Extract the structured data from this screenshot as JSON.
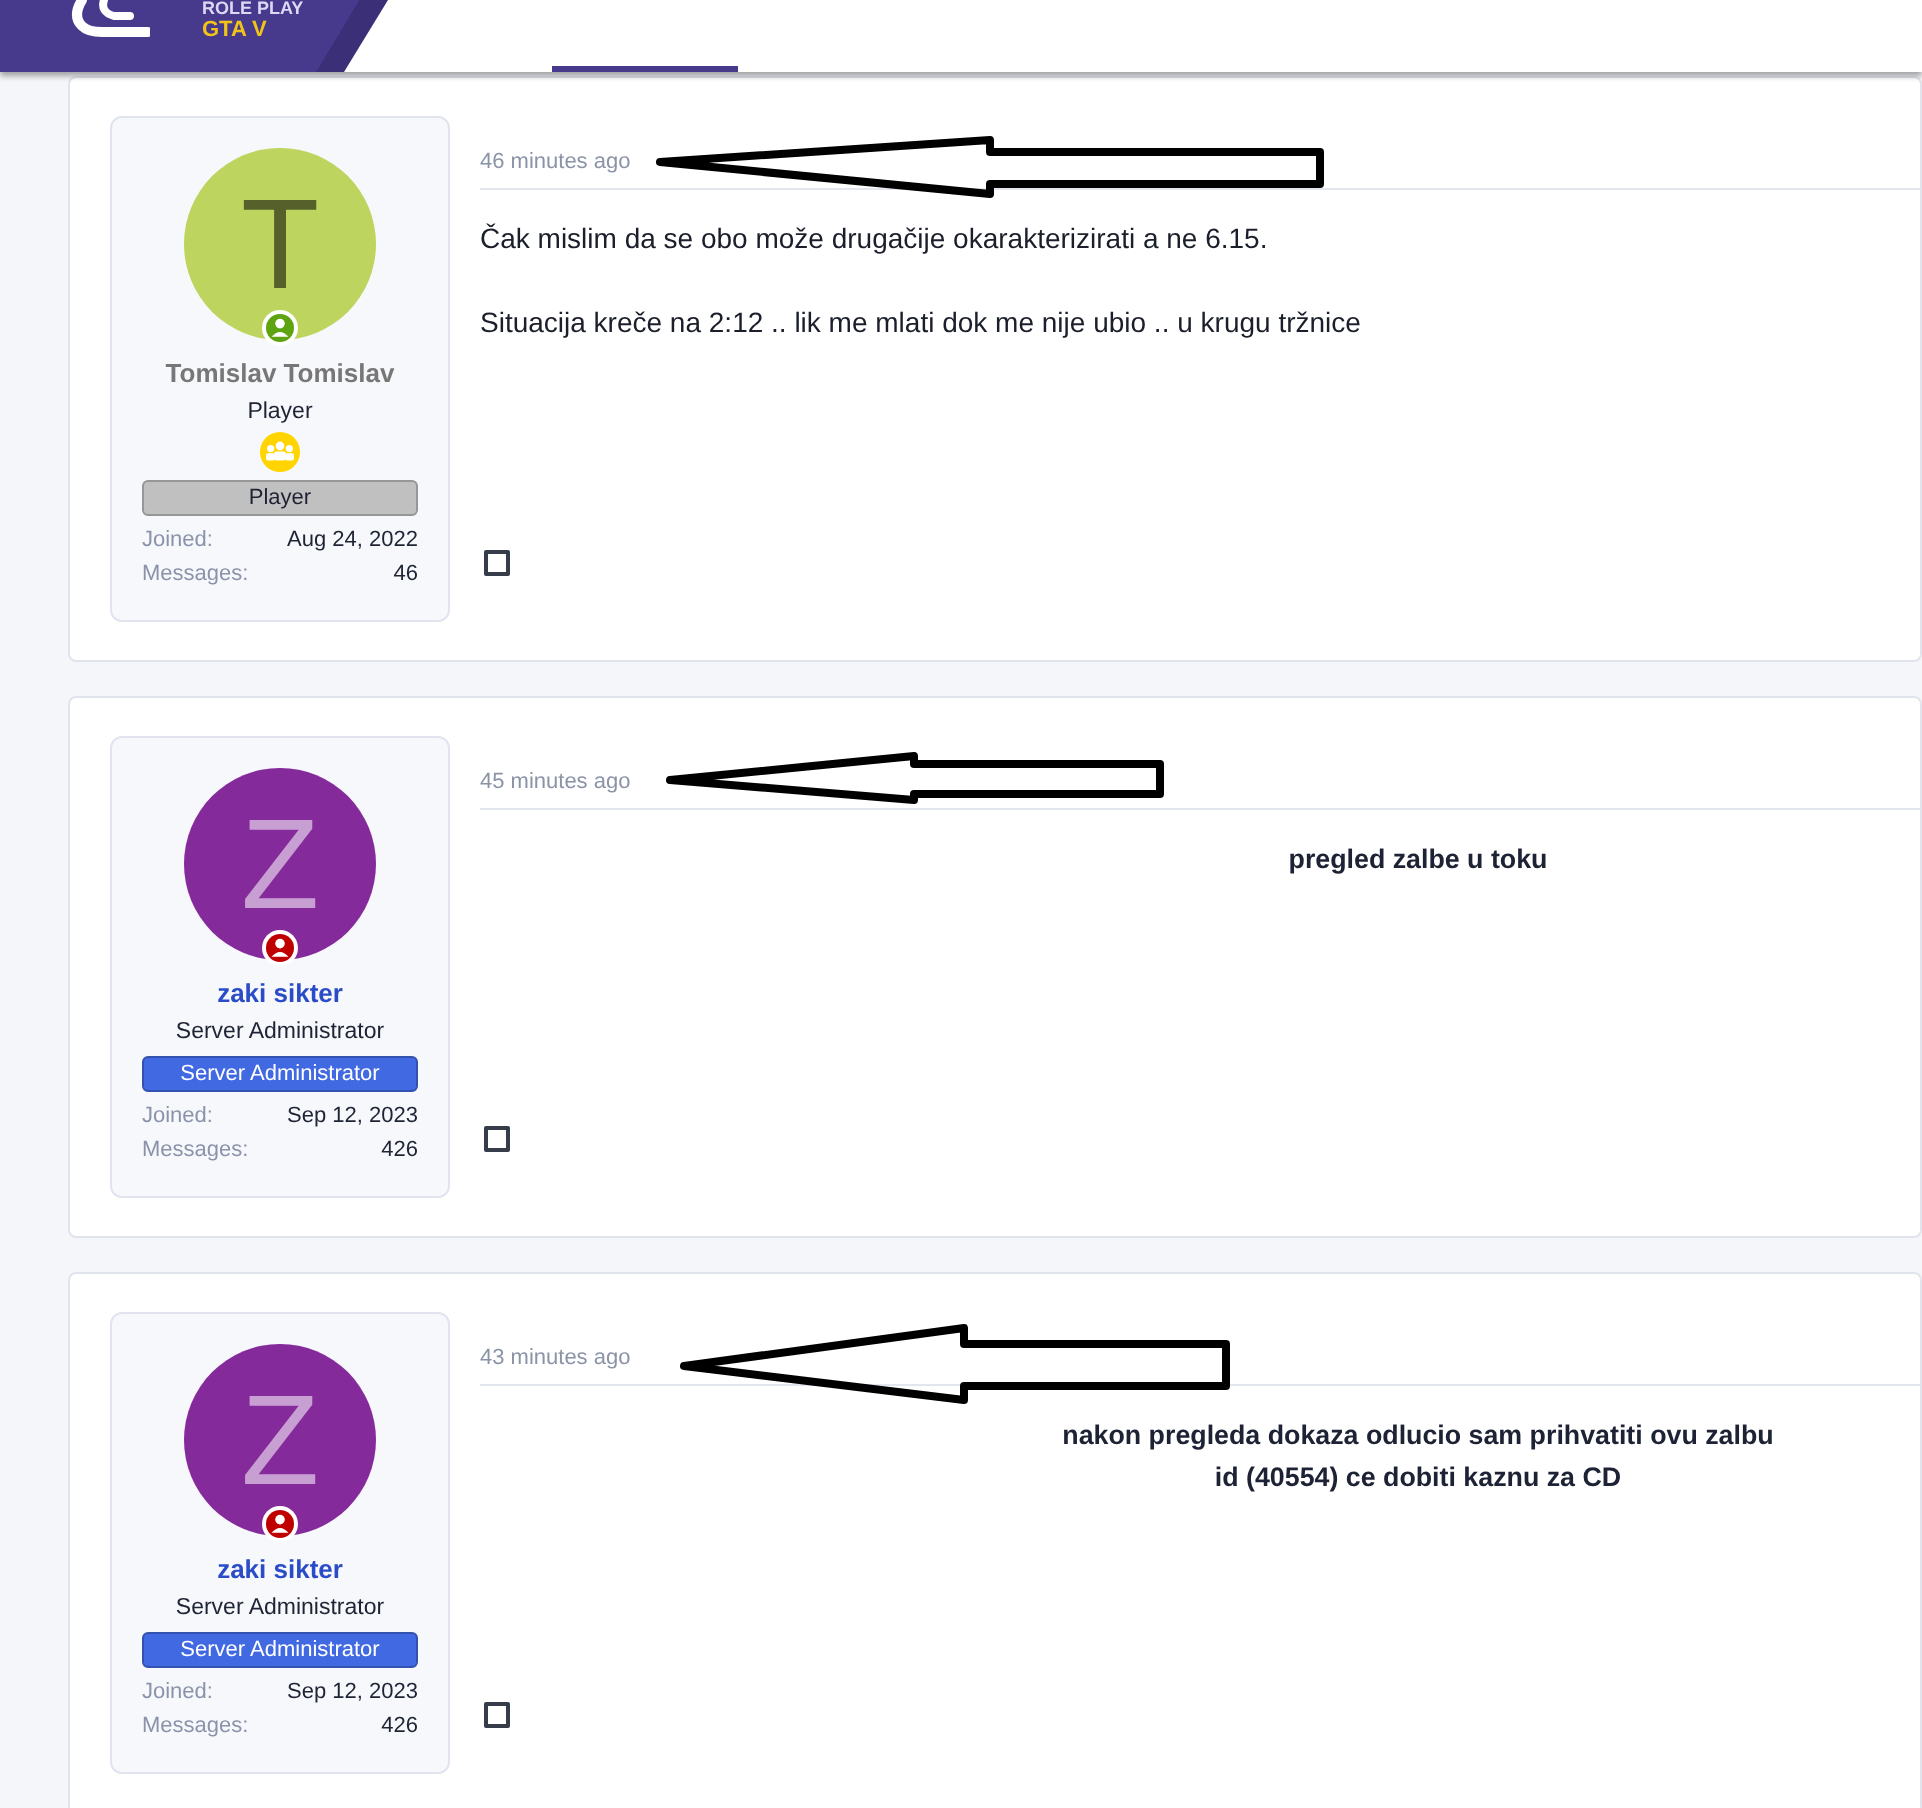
{
  "header": {
    "brand_lines": [
      "ROLE PLAY",
      "GTA V"
    ]
  },
  "posts": [
    {
      "user": {
        "name": "Tomislav Tomislav",
        "color": "#777777",
        "title": "Player",
        "avatar": {
          "letter": "T",
          "color": "#bdd55e"
        },
        "status_badge": {
          "color": "#5ea412"
        },
        "group_icon": true,
        "banner": {
          "label": "Player",
          "color": "#c0c0c0"
        },
        "stats": [
          {
            "label": "Joined:",
            "value": "Aug 24, 2022"
          },
          {
            "label": "Messages:",
            "value": "46"
          }
        ]
      },
      "time": "46 minutes ago",
      "annotation_arrow": true,
      "body": {
        "centered": false,
        "bold": false,
        "paragraphs": [
          [
            "Čak mislim da se obo može drugačije okarakterizirati a ne 6.15."
          ],
          [
            "Situacija kreče na 2:12 .. lik me mlati dok me nije ubio .. u krugu tržnice"
          ]
        ]
      },
      "checkbox": {
        "checked": false
      }
    },
    {
      "user": {
        "name": "zaki sikter",
        "color": "#2a4cc6",
        "title": "Server Administrator",
        "avatar": {
          "letter": "Z",
          "color": "#852a9b"
        },
        "status_badge": {
          "color": "#c00000"
        },
        "group_icon": false,
        "banner": {
          "label": "Server Administrator",
          "color": "#4169e1"
        },
        "stats": [
          {
            "label": "Joined:",
            "value": "Sep 12, 2023"
          },
          {
            "label": "Messages:",
            "value": "426"
          }
        ]
      },
      "time": "45 minutes ago",
      "annotation_arrow": true,
      "body": {
        "centered": true,
        "bold": true,
        "paragraphs": [
          [
            "pregled zalbe u toku"
          ]
        ]
      },
      "checkbox": {
        "checked": false
      }
    },
    {
      "user": {
        "name": "zaki sikter",
        "color": "#2a4cc6",
        "title": "Server Administrator",
        "avatar": {
          "letter": "Z",
          "color": "#852a9b"
        },
        "status_badge": {
          "color": "#c00000"
        },
        "group_icon": false,
        "banner": {
          "label": "Server Administrator",
          "color": "#4169e1"
        },
        "stats": [
          {
            "label": "Joined:",
            "value": "Sep 12, 2023"
          },
          {
            "label": "Messages:",
            "value": "426"
          }
        ]
      },
      "time": "43 minutes ago",
      "annotation_arrow": true,
      "body": {
        "centered": true,
        "bold": true,
        "paragraphs": [
          [
            "nakon pregleda dokaza odlucio sam prihvatiti ovu zalbu",
            "id (40554) ce dobiti kaznu za CD"
          ]
        ]
      },
      "checkbox": {
        "checked": false
      }
    }
  ]
}
